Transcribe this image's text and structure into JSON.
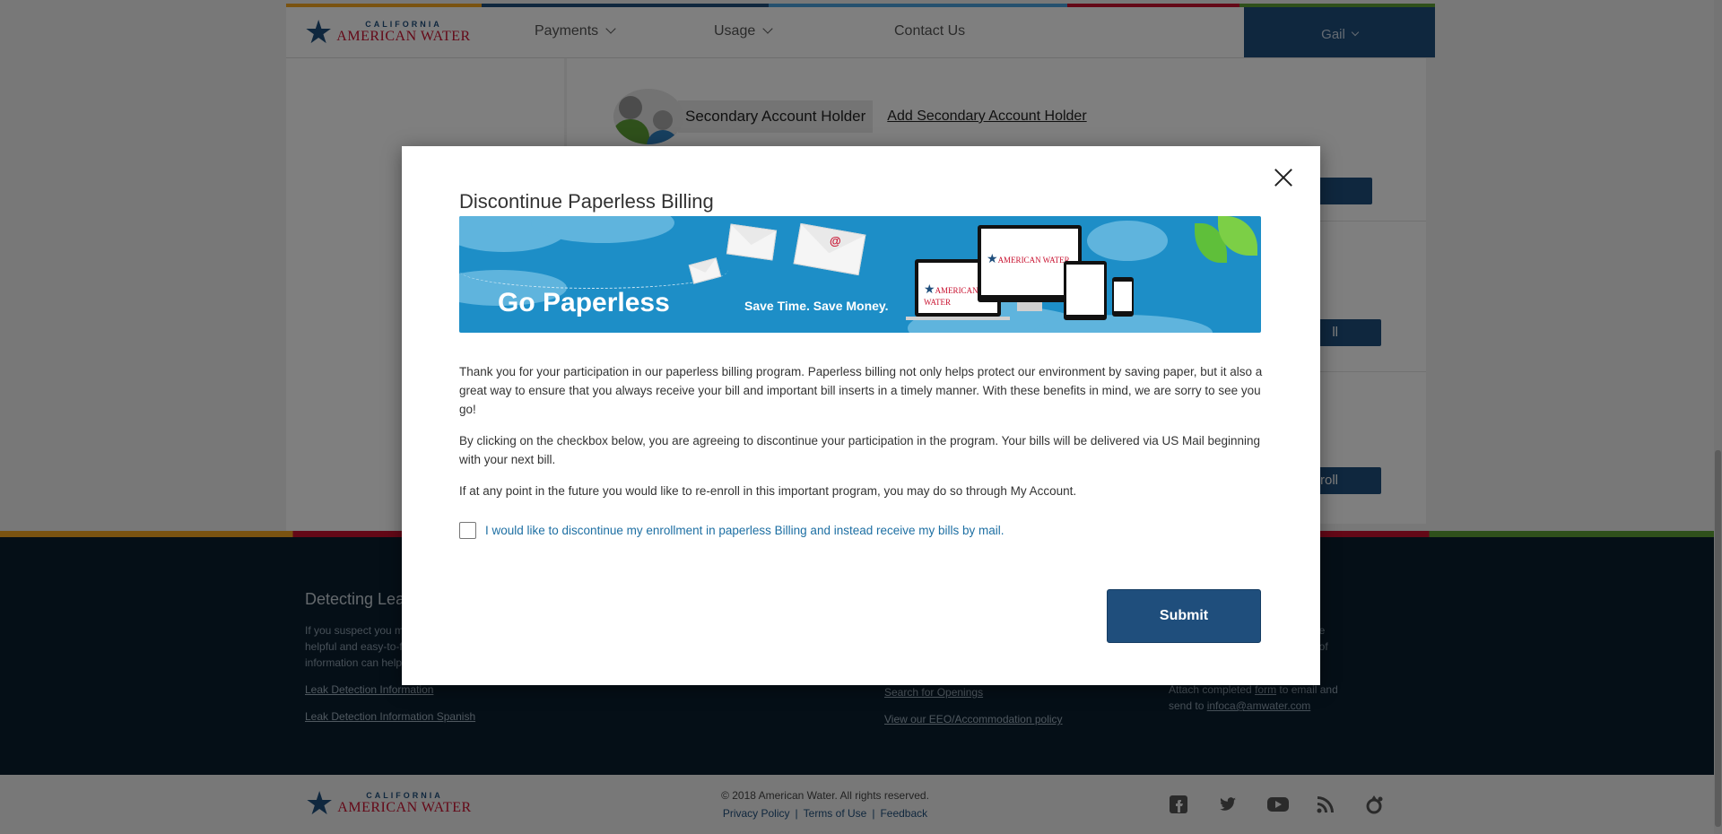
{
  "header": {
    "logo_top": "CALIFORNIA",
    "logo_bottom": "AMERICAN WATER",
    "nav": [
      {
        "label": "Payments"
      },
      {
        "label": "Usage"
      },
      {
        "label": "Contact Us"
      }
    ],
    "user_name": "Gail"
  },
  "account": {
    "secondary_holder_label": "Secondary Account Holder",
    "add_secondary_link": "Add Secondary Account Holder",
    "enroll_fragment_1": "ll",
    "enroll_fragment_2": "nroll"
  },
  "modal": {
    "title": "Discontinue Paperless Billing",
    "banner": {
      "headline": "Go Paperless",
      "tagline": "Save Time. Save Money.",
      "brand": "AMERICAN WATER",
      "at_symbol": "@"
    },
    "paragraphs": [
      "Thank you for your participation in our paperless billing program. Paperless billing not only helps protect our environment by saving paper, but it also a great way to ensure that you always receive your bill and important bill inserts in a timely manner. With these benefits in mind, we are sorry to see you go!",
      "By clicking on the checkbox below, you are agreeing to discontinue your participation in the program. Your bills will be delivered via US Mail beginning with your next bill.",
      "If at any point in the future you would like to re-enroll in this important program, you may do so through My Account."
    ],
    "checkbox_label": "I would like to discontinue my enrollment in paperless Billing and instead receive my bills by mail.",
    "checkbox_checked": false,
    "submit_label": "Submit"
  },
  "footer": {
    "col1_title": "Detecting Lea",
    "col1_text_lines": [
      "If you suspect you m",
      "helpful and easy-to-f",
      "information can help"
    ],
    "col1_links": [
      "Leak Detection Information",
      "Leak Detection Information Spanish"
    ],
    "col3_links": [
      "Search for Openings",
      "View our EEO/Accommodation policy"
    ],
    "col4_title_fragment": "s",
    "col4_text_lines": [
      "provide",
      "result of"
    ],
    "col4_attach_pre": "Attach completed ",
    "col4_attach_link": "form",
    "col4_attach_post": " to email and",
    "col4_send_pre": "send to ",
    "col4_email": "infoca@amwater.com",
    "copyright": "© 2018 American Water. All rights reserved.",
    "legal_links": [
      "Privacy Policy",
      "Terms of Use",
      "Feedback"
    ],
    "legal_sep": "|",
    "social_icons": [
      "facebook-icon",
      "twitter-icon",
      "youtube-icon",
      "rss-icon",
      "water-drop-icon"
    ]
  }
}
